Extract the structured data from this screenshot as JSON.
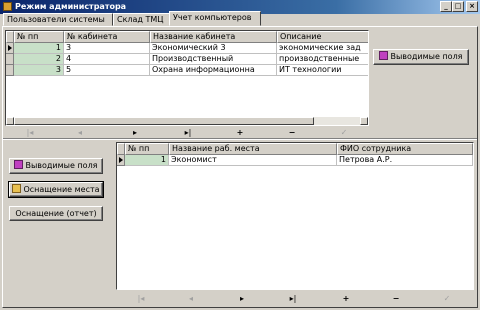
{
  "window": {
    "title": "Режим администратора",
    "min": "_",
    "max": "□",
    "close": "×"
  },
  "tabs": [
    "Пользователи системы",
    "Склад ТМЦ",
    "Учет компьютеров"
  ],
  "top_grid": {
    "columns": [
      "№ пп",
      "№ кабинета",
      "Название кабинета",
      "Описание"
    ],
    "rows": [
      [
        "1",
        "3",
        "Экономический 3",
        "экономические зад"
      ],
      [
        "2",
        "4",
        "Производственный",
        "производственные"
      ],
      [
        "3",
        "5",
        "Охрана информационна",
        "ИТ технологии"
      ]
    ]
  },
  "top_button": "Выводимые поля",
  "nav": {
    "first": "|◂",
    "prior": "◂",
    "next": "▸",
    "last": "▸|",
    "insert": "+",
    "delete": "−",
    "edit": "▲",
    "post": "✓"
  },
  "bottom_grid": {
    "columns": [
      "№ пп",
      "Название раб. места",
      "ФИО сотрудника"
    ],
    "rows": [
      [
        "1",
        "Экономист",
        "Петрова А.Р."
      ]
    ]
  },
  "left_buttons": [
    "Выводимые поля",
    "Оснащение места",
    "Оснащение (отчет)"
  ]
}
